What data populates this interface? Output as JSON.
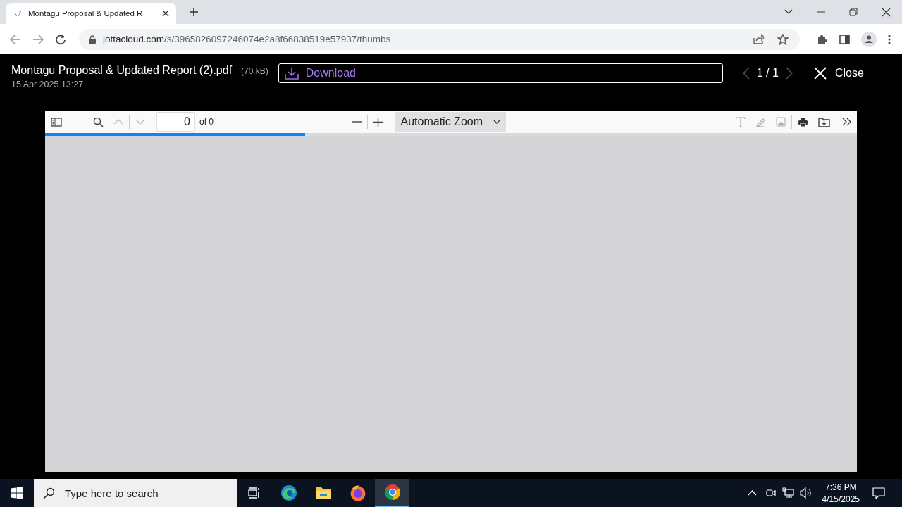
{
  "browser": {
    "tab": {
      "title": "Montagu Proposal & Updated R"
    },
    "address": {
      "host": "jottacloud.com",
      "path": "/s/3965826097246074e2a8f66838519e57937/thumbs"
    }
  },
  "file_header": {
    "name": "Montagu Proposal & Updated Report (2).pdf",
    "size": "(70 kB)",
    "date": "15 Apr 2025 13:27",
    "download_label": "Download",
    "pager": "1 / 1",
    "close_label": "Close"
  },
  "pdf_viewer": {
    "left_tools": [
      {
        "kind": "sidebar",
        "disabled": false
      },
      {
        "kind": "search",
        "disabled": false
      },
      {
        "kind": "previous",
        "disabled": true
      },
      {
        "kind": "next",
        "disabled": true
      }
    ],
    "page_number": "0",
    "page_count": "of 0",
    "zoom": "Automatic Zoom",
    "right_tools": [
      {
        "kind": "text",
        "disabled": true
      },
      {
        "kind": "draw",
        "disabled": true
      },
      {
        "kind": "image",
        "disabled": true
      },
      {
        "kind": "print",
        "disabled": false
      },
      {
        "kind": "save",
        "disabled": false
      },
      {
        "kind": "more",
        "disabled": false
      }
    ],
    "loading": {
      "level": 0.32
    }
  },
  "taskbar": {
    "search_placeholder": "Type here to search",
    "apps": [
      {
        "kind": "task-view",
        "selected": false
      },
      {
        "kind": "edge",
        "selected": false
      },
      {
        "kind": "files",
        "selected": false
      },
      {
        "kind": "firefox",
        "selected": false
      },
      {
        "kind": "chrome",
        "selected": true
      }
    ],
    "time": "7:36 PM",
    "date": "4/15/2025"
  }
}
